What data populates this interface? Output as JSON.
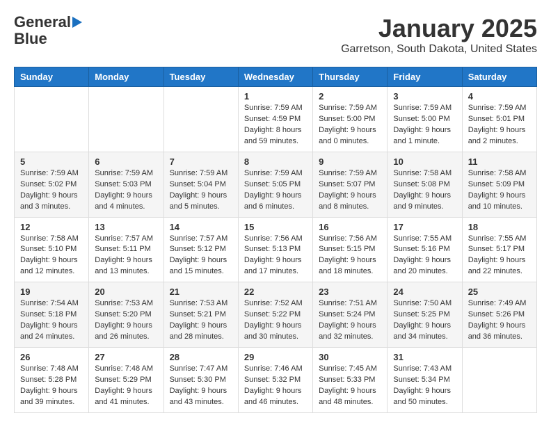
{
  "logo": {
    "line1": "General",
    "line2": "Blue"
  },
  "title": "January 2025",
  "subtitle": "Garretson, South Dakota, United States",
  "weekdays": [
    "Sunday",
    "Monday",
    "Tuesday",
    "Wednesday",
    "Thursday",
    "Friday",
    "Saturday"
  ],
  "weeks": [
    [
      {
        "day": "",
        "content": ""
      },
      {
        "day": "",
        "content": ""
      },
      {
        "day": "",
        "content": ""
      },
      {
        "day": "1",
        "content": "Sunrise: 7:59 AM\nSunset: 4:59 PM\nDaylight: 8 hours and 59 minutes."
      },
      {
        "day": "2",
        "content": "Sunrise: 7:59 AM\nSunset: 5:00 PM\nDaylight: 9 hours and 0 minutes."
      },
      {
        "day": "3",
        "content": "Sunrise: 7:59 AM\nSunset: 5:00 PM\nDaylight: 9 hours and 1 minute."
      },
      {
        "day": "4",
        "content": "Sunrise: 7:59 AM\nSunset: 5:01 PM\nDaylight: 9 hours and 2 minutes."
      }
    ],
    [
      {
        "day": "5",
        "content": "Sunrise: 7:59 AM\nSunset: 5:02 PM\nDaylight: 9 hours and 3 minutes."
      },
      {
        "day": "6",
        "content": "Sunrise: 7:59 AM\nSunset: 5:03 PM\nDaylight: 9 hours and 4 minutes."
      },
      {
        "day": "7",
        "content": "Sunrise: 7:59 AM\nSunset: 5:04 PM\nDaylight: 9 hours and 5 minutes."
      },
      {
        "day": "8",
        "content": "Sunrise: 7:59 AM\nSunset: 5:05 PM\nDaylight: 9 hours and 6 minutes."
      },
      {
        "day": "9",
        "content": "Sunrise: 7:59 AM\nSunset: 5:07 PM\nDaylight: 9 hours and 8 minutes."
      },
      {
        "day": "10",
        "content": "Sunrise: 7:58 AM\nSunset: 5:08 PM\nDaylight: 9 hours and 9 minutes."
      },
      {
        "day": "11",
        "content": "Sunrise: 7:58 AM\nSunset: 5:09 PM\nDaylight: 9 hours and 10 minutes."
      }
    ],
    [
      {
        "day": "12",
        "content": "Sunrise: 7:58 AM\nSunset: 5:10 PM\nDaylight: 9 hours and 12 minutes."
      },
      {
        "day": "13",
        "content": "Sunrise: 7:57 AM\nSunset: 5:11 PM\nDaylight: 9 hours and 13 minutes."
      },
      {
        "day": "14",
        "content": "Sunrise: 7:57 AM\nSunset: 5:12 PM\nDaylight: 9 hours and 15 minutes."
      },
      {
        "day": "15",
        "content": "Sunrise: 7:56 AM\nSunset: 5:13 PM\nDaylight: 9 hours and 17 minutes."
      },
      {
        "day": "16",
        "content": "Sunrise: 7:56 AM\nSunset: 5:15 PM\nDaylight: 9 hours and 18 minutes."
      },
      {
        "day": "17",
        "content": "Sunrise: 7:55 AM\nSunset: 5:16 PM\nDaylight: 9 hours and 20 minutes."
      },
      {
        "day": "18",
        "content": "Sunrise: 7:55 AM\nSunset: 5:17 PM\nDaylight: 9 hours and 22 minutes."
      }
    ],
    [
      {
        "day": "19",
        "content": "Sunrise: 7:54 AM\nSunset: 5:18 PM\nDaylight: 9 hours and 24 minutes."
      },
      {
        "day": "20",
        "content": "Sunrise: 7:53 AM\nSunset: 5:20 PM\nDaylight: 9 hours and 26 minutes."
      },
      {
        "day": "21",
        "content": "Sunrise: 7:53 AM\nSunset: 5:21 PM\nDaylight: 9 hours and 28 minutes."
      },
      {
        "day": "22",
        "content": "Sunrise: 7:52 AM\nSunset: 5:22 PM\nDaylight: 9 hours and 30 minutes."
      },
      {
        "day": "23",
        "content": "Sunrise: 7:51 AM\nSunset: 5:24 PM\nDaylight: 9 hours and 32 minutes."
      },
      {
        "day": "24",
        "content": "Sunrise: 7:50 AM\nSunset: 5:25 PM\nDaylight: 9 hours and 34 minutes."
      },
      {
        "day": "25",
        "content": "Sunrise: 7:49 AM\nSunset: 5:26 PM\nDaylight: 9 hours and 36 minutes."
      }
    ],
    [
      {
        "day": "26",
        "content": "Sunrise: 7:48 AM\nSunset: 5:28 PM\nDaylight: 9 hours and 39 minutes."
      },
      {
        "day": "27",
        "content": "Sunrise: 7:48 AM\nSunset: 5:29 PM\nDaylight: 9 hours and 41 minutes."
      },
      {
        "day": "28",
        "content": "Sunrise: 7:47 AM\nSunset: 5:30 PM\nDaylight: 9 hours and 43 minutes."
      },
      {
        "day": "29",
        "content": "Sunrise: 7:46 AM\nSunset: 5:32 PM\nDaylight: 9 hours and 46 minutes."
      },
      {
        "day": "30",
        "content": "Sunrise: 7:45 AM\nSunset: 5:33 PM\nDaylight: 9 hours and 48 minutes."
      },
      {
        "day": "31",
        "content": "Sunrise: 7:43 AM\nSunset: 5:34 PM\nDaylight: 9 hours and 50 minutes."
      },
      {
        "day": "",
        "content": ""
      }
    ]
  ]
}
